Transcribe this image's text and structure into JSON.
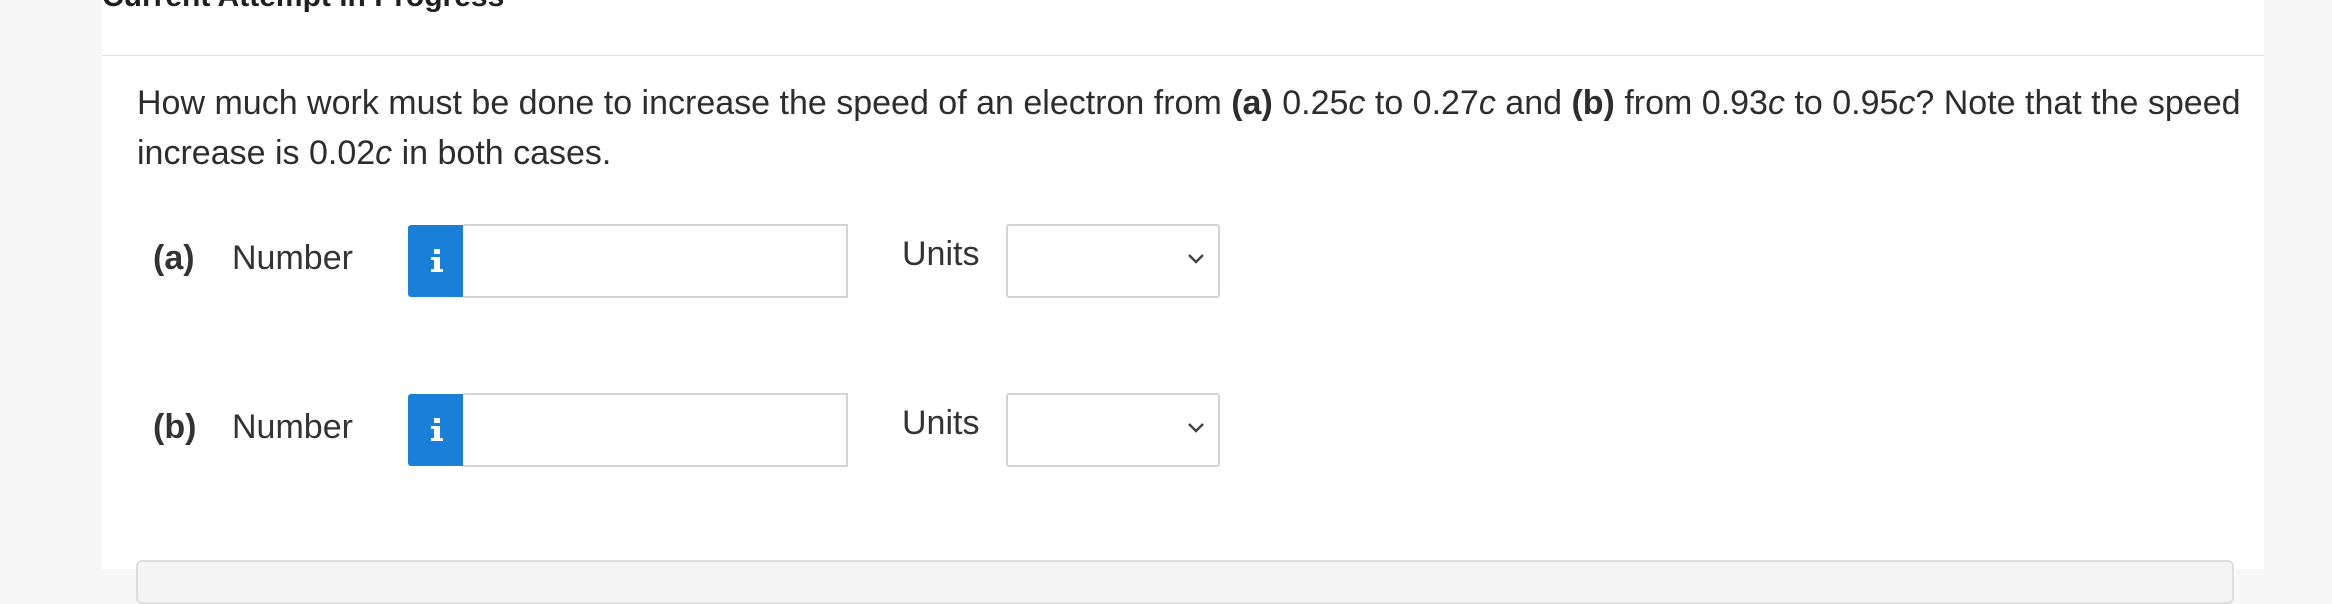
{
  "header": {
    "title": "Current Attempt in Progress"
  },
  "question": {
    "p1": "How much work must be done to increase the speed of an electron from ",
    "a_label": "(a)",
    "p2": " 0.25",
    "c1": "c",
    "p3": " to 0.27",
    "c2": "c",
    "p4": " and ",
    "b_label": "(b)",
    "p5": " from 0.93",
    "c3": "c",
    "p6": " to 0.95",
    "c4": "c",
    "p7": "? Note that the speed increase is 0.02",
    "c5": "c",
    "p8": " in both cases."
  },
  "parts": [
    {
      "label": "(a)",
      "number_label": "Number",
      "number_value": "",
      "units_label": "Units",
      "units_selected": ""
    },
    {
      "label": "(b)",
      "number_label": "Number",
      "number_value": "",
      "units_label": "Units",
      "units_selected": ""
    }
  ],
  "icons": {
    "info": "info-icon",
    "dropdown": "chevron-down-icon"
  },
  "colors": {
    "info_button": "#1a7fd8",
    "border": "#d3d3d3",
    "background": "#f7f7f7"
  }
}
